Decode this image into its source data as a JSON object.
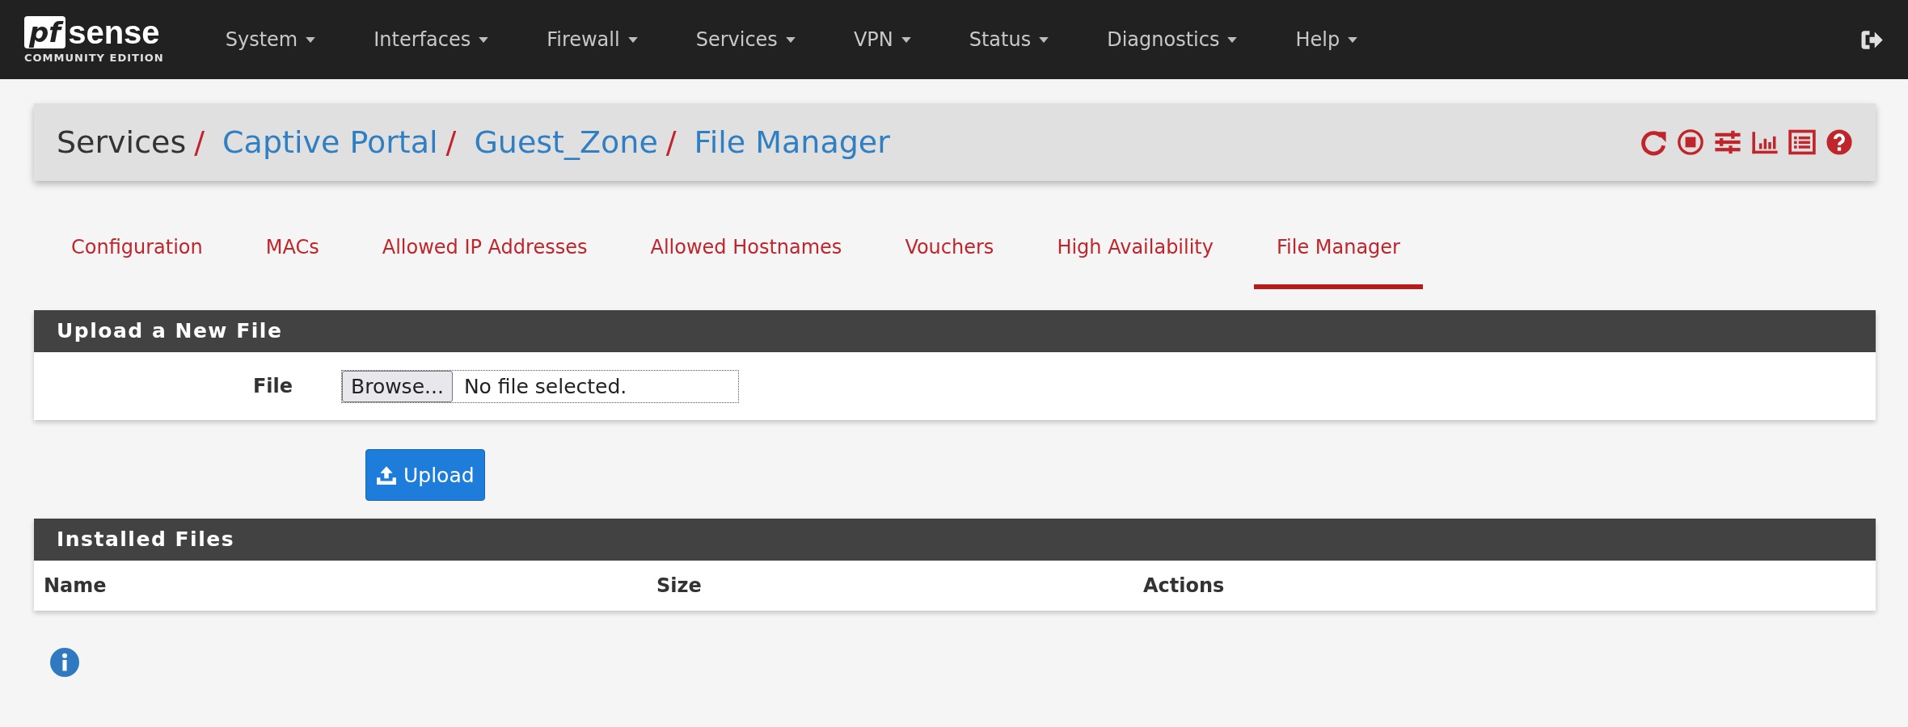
{
  "navbar": {
    "logo": {
      "mark": "pf",
      "word": "sense",
      "edition": "COMMUNITY EDITION"
    },
    "menu": [
      {
        "label": "System",
        "dropdown": true
      },
      {
        "label": "Interfaces",
        "dropdown": true
      },
      {
        "label": "Firewall",
        "dropdown": true
      },
      {
        "label": "Services",
        "dropdown": true
      },
      {
        "label": "VPN",
        "dropdown": true
      },
      {
        "label": "Status",
        "dropdown": true
      },
      {
        "label": "Diagnostics",
        "dropdown": true
      },
      {
        "label": "Help",
        "dropdown": true
      }
    ]
  },
  "breadcrumb": {
    "items": [
      {
        "label": "Services",
        "link": false,
        "separator": "/"
      },
      {
        "label": "Captive Portal",
        "link": true,
        "separator": "/"
      },
      {
        "label": "Guest_Zone",
        "link": true,
        "separator": "/"
      },
      {
        "label": "File Manager",
        "link": true
      }
    ],
    "actions": [
      {
        "kind": "restart"
      },
      {
        "kind": "stop"
      },
      {
        "kind": "settings"
      },
      {
        "kind": "chart"
      },
      {
        "kind": "log"
      },
      {
        "kind": "help"
      }
    ]
  },
  "tabs": [
    {
      "label": "Configuration",
      "selected": false
    },
    {
      "label": "MACs",
      "selected": false
    },
    {
      "label": "Allowed IP Addresses",
      "selected": false
    },
    {
      "label": "Allowed Hostnames",
      "selected": false
    },
    {
      "label": "Vouchers",
      "selected": false
    },
    {
      "label": "High Availability",
      "selected": false
    },
    {
      "label": "File Manager",
      "selected": true
    }
  ],
  "upload_panel": {
    "title": "Upload a New File",
    "field_label": "File",
    "browse_button": "Browse...",
    "file_status": "No file selected."
  },
  "upload_button": "Upload",
  "installed_panel": {
    "title": "Installed Files",
    "columns": [
      "Name",
      "Size",
      "Actions"
    ]
  }
}
